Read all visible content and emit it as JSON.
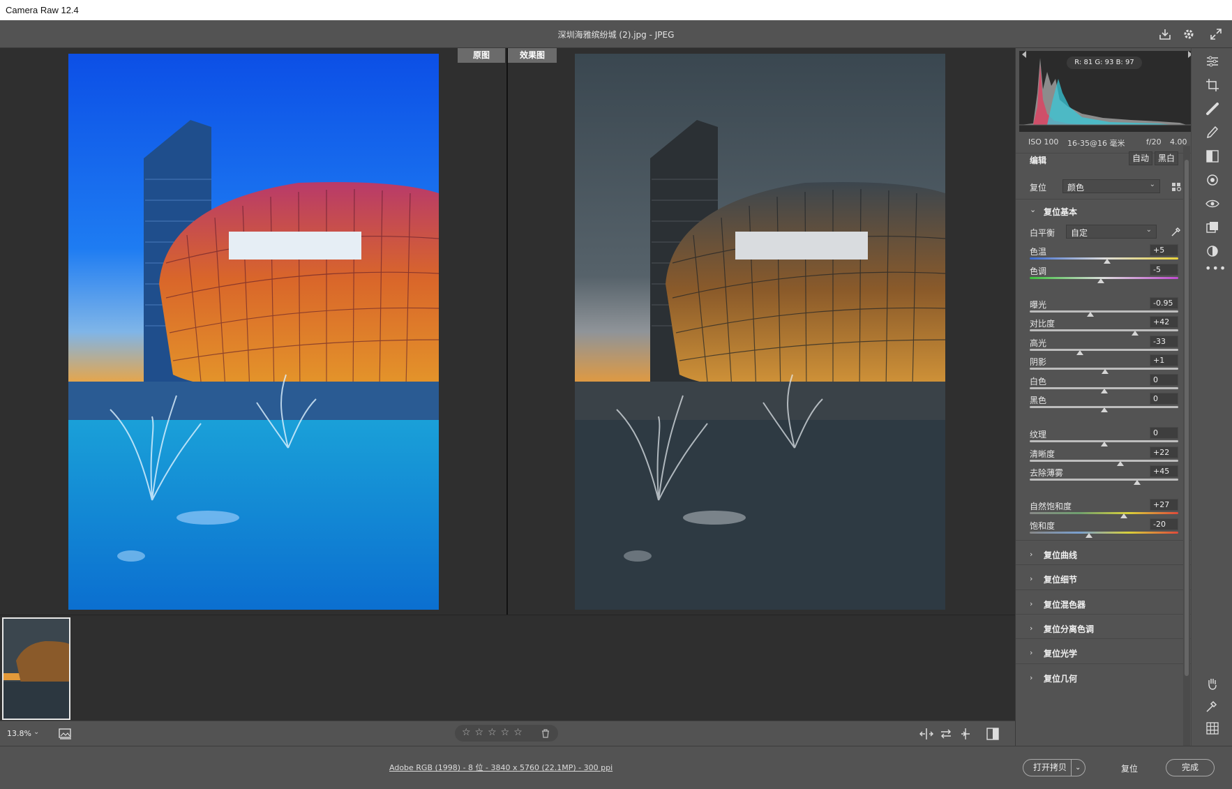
{
  "app": {
    "title": "Camera Raw 12.4"
  },
  "topbar": {
    "filename": "深圳海雅缤纷城 (2).jpg -  JPEG"
  },
  "view": {
    "before_label": "原图",
    "after_label": "效果图",
    "zoom": "13.8%"
  },
  "rating": {
    "stars": 0,
    "max": 5
  },
  "footer": {
    "info": "Adobe RGB (1998) - 8 位 - 3840 x 5760 (22.1MP) - 300 ppi",
    "open_copy": "打开拷贝",
    "reset": "复位",
    "done": "完成"
  },
  "histogram": {
    "rgb": "R: 81   G: 93   B: 97"
  },
  "exif": {
    "iso": "ISO 100",
    "lens": "16-35@16 毫米",
    "aperture": "f/20",
    "ev": "4.00"
  },
  "edit": {
    "title": "编辑",
    "auto": "自动",
    "bw": "黑白"
  },
  "profile": {
    "label": "复位",
    "value": "颜色"
  },
  "basic": {
    "title": "复位基本",
    "wb_label": "白平衡",
    "wb_value": "自定",
    "sliders": [
      {
        "label": "色温",
        "value": "+5",
        "pos": 0.52
      },
      {
        "label": "色调",
        "value": "-5",
        "pos": 0.48
      },
      {
        "label": "曝光",
        "value": "-0.95",
        "pos": 0.41
      },
      {
        "label": "对比度",
        "value": "+42",
        "pos": 0.71
      },
      {
        "label": "高光",
        "value": "-33",
        "pos": 0.34
      },
      {
        "label": "阴影",
        "value": "+1",
        "pos": 0.505
      },
      {
        "label": "白色",
        "value": "0",
        "pos": 0.5
      },
      {
        "label": "黑色",
        "value": "0",
        "pos": 0.5
      },
      {
        "label": "纹理",
        "value": "0",
        "pos": 0.5
      },
      {
        "label": "清晰度",
        "value": "+22",
        "pos": 0.61
      },
      {
        "label": "去除薄雾",
        "value": "+45",
        "pos": 0.725
      },
      {
        "label": "自然饱和度",
        "value": "+27",
        "pos": 0.635
      },
      {
        "label": "饱和度",
        "value": "-20",
        "pos": 0.4
      }
    ]
  },
  "sections": [
    {
      "label": "复位曲线"
    },
    {
      "label": "复位细节"
    },
    {
      "label": "复位混色器"
    },
    {
      "label": "复位分离色调"
    },
    {
      "label": "复位光学"
    },
    {
      "label": "复位几何"
    }
  ],
  "colors": {
    "panel": "#535353",
    "canvas": "#2f2f2f",
    "accent": "#ffffff"
  }
}
